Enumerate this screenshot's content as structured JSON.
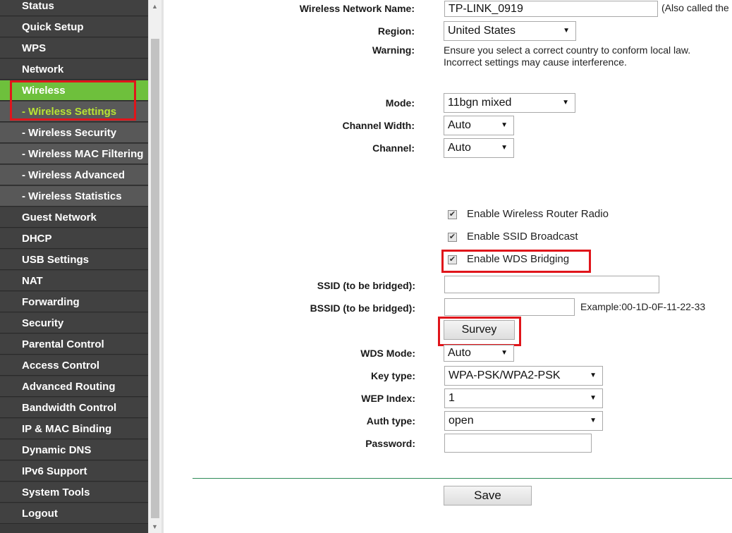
{
  "sidebar": {
    "items": [
      {
        "label": "Status",
        "kind": "main"
      },
      {
        "label": "Quick Setup",
        "kind": "main"
      },
      {
        "label": "WPS",
        "kind": "main"
      },
      {
        "label": "Network",
        "kind": "main"
      },
      {
        "label": "Wireless",
        "kind": "active"
      },
      {
        "label": "- Wireless Settings",
        "kind": "active-sub"
      },
      {
        "label": "- Wireless Security",
        "kind": "sub"
      },
      {
        "label": "- Wireless MAC Filtering",
        "kind": "sub"
      },
      {
        "label": "- Wireless Advanced",
        "kind": "sub"
      },
      {
        "label": "- Wireless Statistics",
        "kind": "sub"
      },
      {
        "label": "Guest Network",
        "kind": "main"
      },
      {
        "label": "DHCP",
        "kind": "main"
      },
      {
        "label": "USB Settings",
        "kind": "main"
      },
      {
        "label": "NAT",
        "kind": "main"
      },
      {
        "label": "Forwarding",
        "kind": "main"
      },
      {
        "label": "Security",
        "kind": "main"
      },
      {
        "label": "Parental Control",
        "kind": "main"
      },
      {
        "label": "Access Control",
        "kind": "main"
      },
      {
        "label": "Advanced Routing",
        "kind": "main"
      },
      {
        "label": "Bandwidth Control",
        "kind": "main"
      },
      {
        "label": "IP & MAC Binding",
        "kind": "main"
      },
      {
        "label": "Dynamic DNS",
        "kind": "main"
      },
      {
        "label": "IPv6 Support",
        "kind": "main"
      },
      {
        "label": "System Tools",
        "kind": "main"
      },
      {
        "label": "Logout",
        "kind": "main"
      }
    ]
  },
  "form": {
    "network_name_label": "Wireless Network Name:",
    "network_name_value": "TP-LINK_0919",
    "network_name_hint": "(Also called the",
    "region_label": "Region:",
    "region_value": "United States",
    "warning_label": "Warning:",
    "warning_line1": "Ensure you select a correct country to conform local law.",
    "warning_line2": "Incorrect settings may cause interference.",
    "mode_label": "Mode:",
    "mode_value": "11bgn mixed",
    "channel_width_label": "Channel Width:",
    "channel_width_value": "Auto",
    "channel_label": "Channel:",
    "channel_value": "Auto",
    "enable_radio_label": "Enable Wireless Router Radio",
    "enable_ssid_broadcast_label": "Enable SSID Broadcast",
    "enable_wds_label": "Enable WDS Bridging",
    "ssid_bridged_label": "SSID (to be bridged):",
    "ssid_bridged_value": "",
    "bssid_bridged_label": "BSSID (to be bridged):",
    "bssid_bridged_value": "",
    "bssid_example": "Example:00-1D-0F-11-22-33",
    "survey_button": "Survey",
    "wds_mode_label": "WDS Mode:",
    "wds_mode_value": "Auto",
    "key_type_label": "Key type:",
    "key_type_value": "WPA-PSK/WPA2-PSK",
    "wep_index_label": "WEP Index:",
    "wep_index_value": "1",
    "auth_type_label": "Auth type:",
    "auth_type_value": "open",
    "password_label": "Password:",
    "password_value": "",
    "save_button": "Save"
  },
  "checkbox_states": {
    "radio": true,
    "ssid_broadcast": true,
    "wds": true
  },
  "colors": {
    "sidebar_bg": "#414141",
    "active_green": "#6ec03c",
    "active_sub_text": "#b8e334",
    "highlight_red": "#e0151b",
    "divider_green": "#2e8b57"
  },
  "icons": {
    "checkbox": "check-mark-icon",
    "dropdown": "dropdown-caret-icon",
    "scroll": "scroll-arrow-icon"
  }
}
